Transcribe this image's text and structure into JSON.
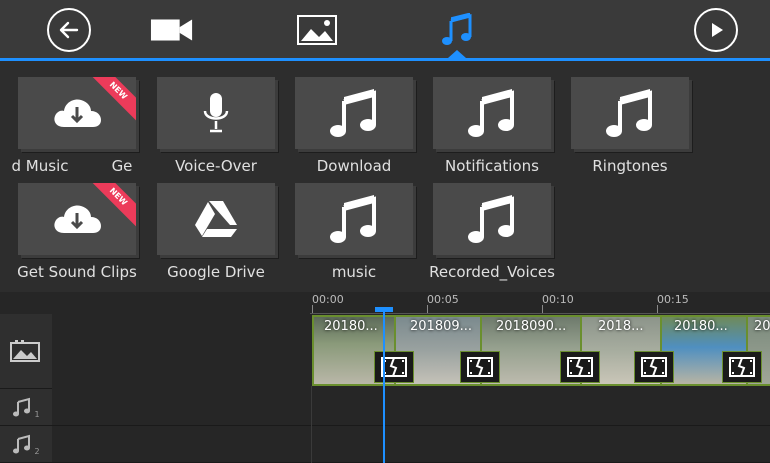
{
  "toolbar": {
    "back_icon": "back-arrow-icon",
    "tabs": [
      {
        "name": "video-tab",
        "icon": "video-camera-icon"
      },
      {
        "name": "image-tab",
        "icon": "image-icon"
      },
      {
        "name": "audio-tab",
        "icon": "music-note-icon",
        "active": true
      }
    ],
    "play_icon": "play-icon",
    "accent": "#1e90ff"
  },
  "sources": [
    {
      "label": "d Music",
      "extra_label": "Ge",
      "icon": "cloud-download-icon",
      "badge": "NEW"
    },
    {
      "label": "Voice-Over",
      "icon": "microphone-icon"
    },
    {
      "label": "Download",
      "icon": "music-note-icon"
    },
    {
      "label": "Notifications",
      "icon": "music-note-icon"
    },
    {
      "label": "Ringtones",
      "icon": "music-note-icon"
    },
    {
      "label": "Get Sound Clips",
      "icon": "cloud-download-icon",
      "badge": "NEW"
    },
    {
      "label": "Google Drive",
      "icon": "google-drive-icon"
    },
    {
      "label": "music",
      "icon": "music-note-icon"
    },
    {
      "label": "Recorded_Voices",
      "icon": "music-note-icon"
    }
  ],
  "timeline": {
    "ruler": [
      "00:00",
      "00:05",
      "00:10",
      "00:15"
    ],
    "clips": [
      "20180...",
      "201809...",
      "2018090...",
      "2018...",
      "20180...",
      "20"
    ],
    "audio_tracks": [
      "1",
      "2"
    ]
  },
  "colors": {
    "badge": "#ec3b5a",
    "clip_border": "#6a8f2e"
  }
}
